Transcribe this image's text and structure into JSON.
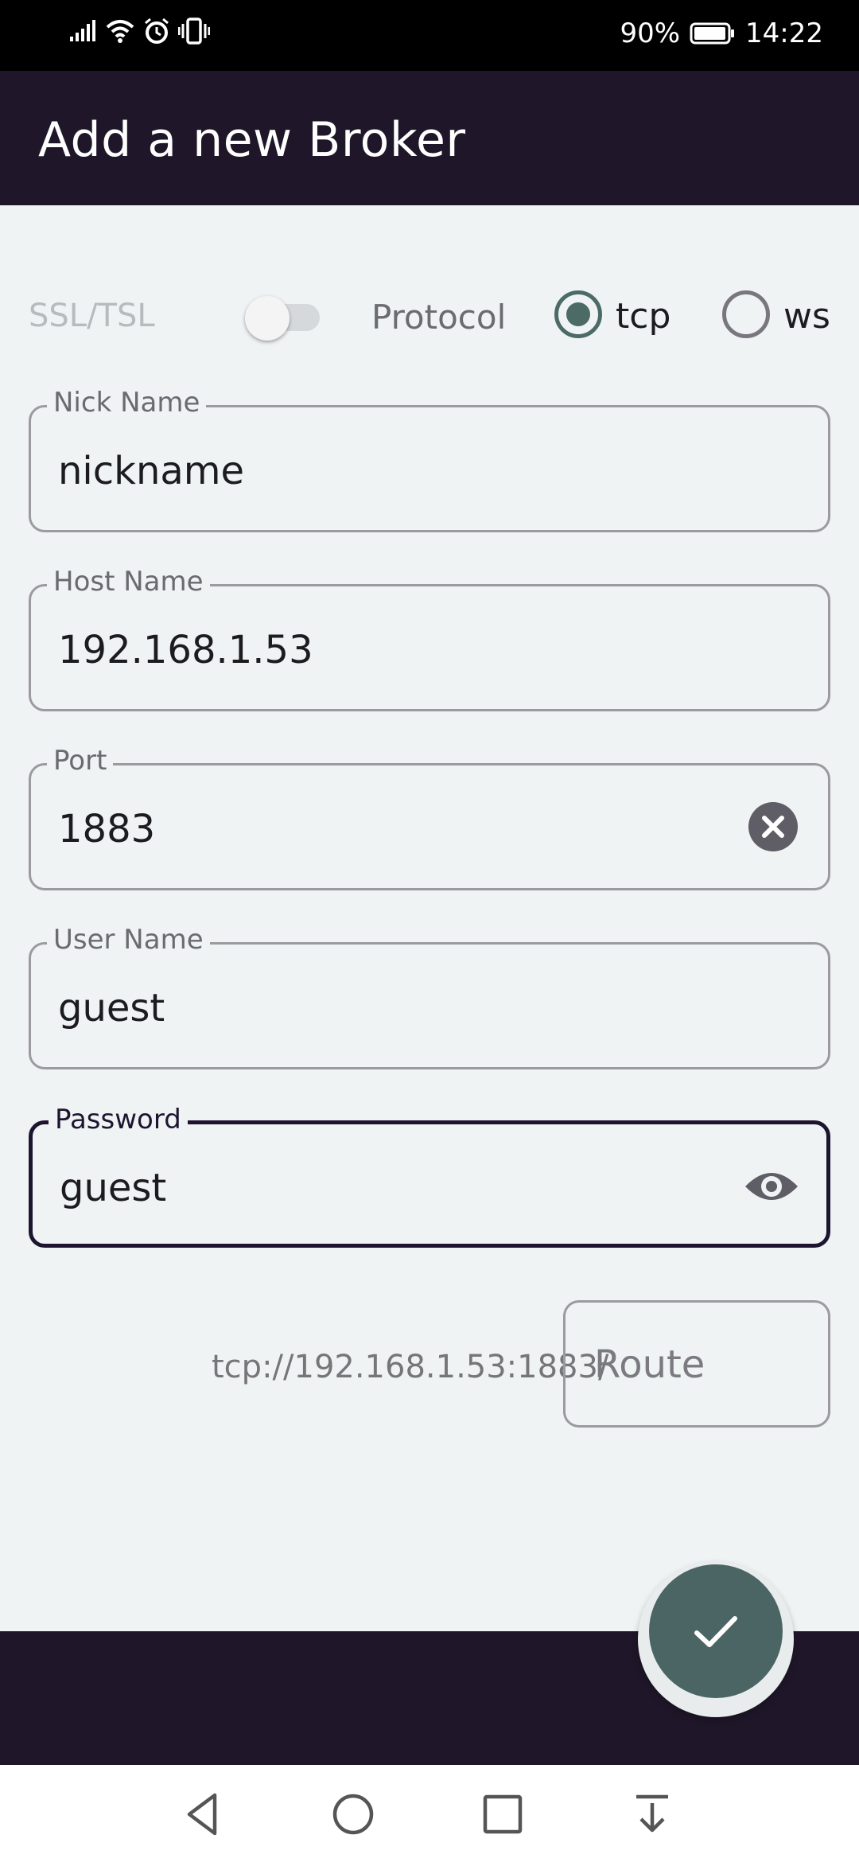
{
  "status_bar": {
    "battery_text": "90%",
    "time": "14:22",
    "icons": [
      "signal-icon",
      "wifi-icon",
      "alarm-icon",
      "vibrate-icon",
      "battery-icon"
    ]
  },
  "app_bar": {
    "title": "Add a new Broker"
  },
  "options": {
    "ssl_label": "SSL/TSL",
    "ssl_enabled": false,
    "protocol_label": "Protocol",
    "protocols": [
      {
        "label": "tcp",
        "selected": true
      },
      {
        "label": "ws",
        "selected": false
      }
    ]
  },
  "fields": {
    "nick_name": {
      "label": "Nick Name",
      "value": "nickname"
    },
    "host_name": {
      "label": "Host Name",
      "value": "192.168.1.53"
    },
    "port": {
      "label": "Port",
      "value": "1883"
    },
    "user_name": {
      "label": "User Name",
      "value": "guest"
    },
    "password": {
      "label": "Password",
      "value": "guest"
    }
  },
  "url_preview": "tcp://192.168.1.53:1883/",
  "route": {
    "placeholder": "Route"
  },
  "colors": {
    "app_bar": "#1f1729",
    "accent": "#4c6b66",
    "fab": "#4a6563",
    "background": "#eff3f4"
  }
}
